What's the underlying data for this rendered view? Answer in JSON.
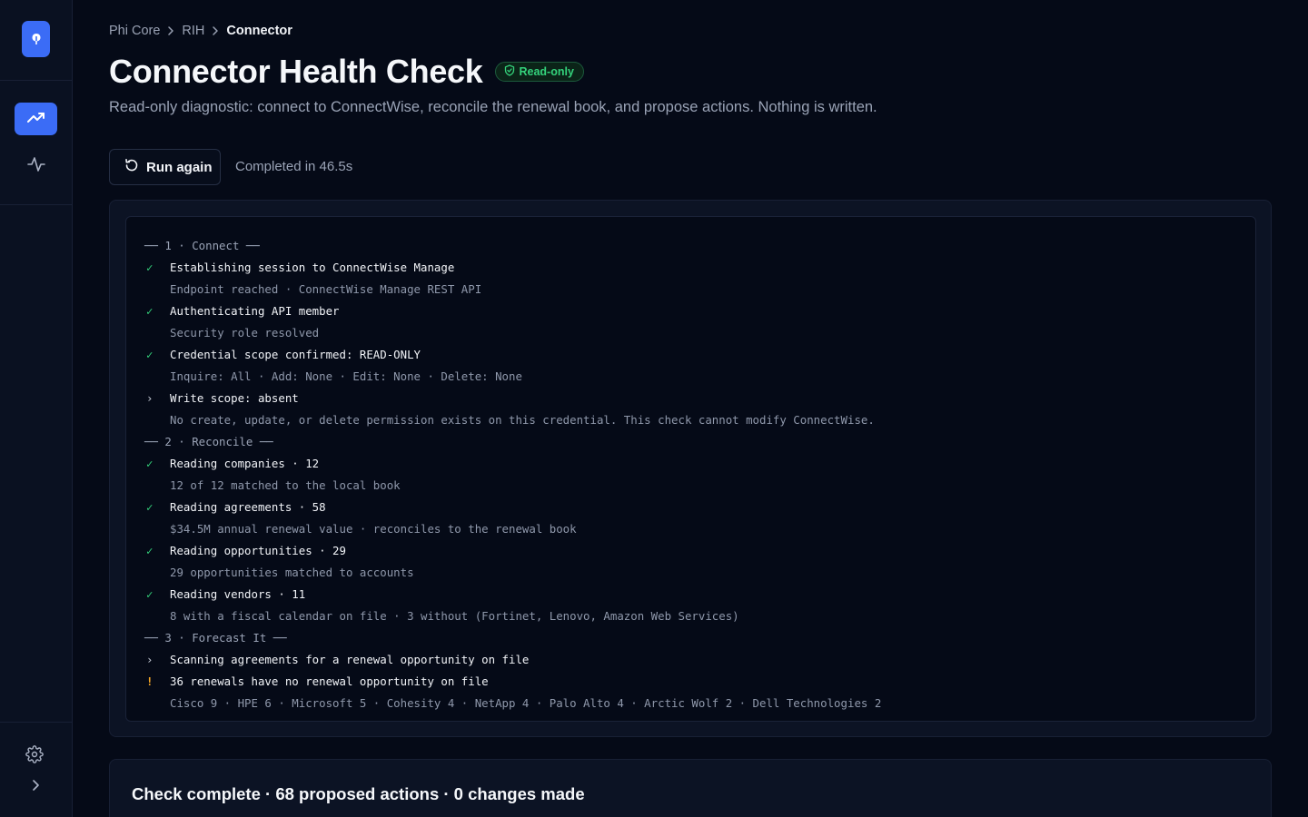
{
  "colors": {
    "accent": "#3b6cf6",
    "success": "#34d27b",
    "warning": "#f5a524",
    "background": "#050a17"
  },
  "sidebar": {
    "logo_icon": "leaf-logo-icon",
    "nav": [
      {
        "icon": "trending-up-icon",
        "active": true
      },
      {
        "icon": "activity-pulse-icon",
        "active": false
      }
    ],
    "footer": [
      {
        "icon": "gear-icon"
      },
      {
        "icon": "chevron-right-icon"
      }
    ]
  },
  "breadcrumb": [
    "Phi Core",
    "RIH",
    "Connector"
  ],
  "header": {
    "title": "Connector Health Check",
    "badge": "Read-only",
    "subtitle": "Read-only diagnostic: connect to ConnectWise, reconcile the renewal book, and propose actions. Nothing is written."
  },
  "actions": {
    "run_again": "Run again",
    "completed": "Completed in 46.5s"
  },
  "log": [
    {
      "kind": "section",
      "text": "── 1 · Connect ──"
    },
    {
      "kind": "main",
      "marker": "ok",
      "text": "Establishing session to ConnectWise Manage"
    },
    {
      "kind": "sub",
      "text": "Endpoint reached · ConnectWise Manage REST API"
    },
    {
      "kind": "main",
      "marker": "ok",
      "text": "Authenticating API member"
    },
    {
      "kind": "sub",
      "text": "Security role resolved"
    },
    {
      "kind": "main",
      "marker": "ok",
      "text": "Credential scope confirmed: READ-ONLY"
    },
    {
      "kind": "sub",
      "text": "Inquire: All · Add: None · Edit: None · Delete: None"
    },
    {
      "kind": "main",
      "marker": "arrow",
      "text": "Write scope: absent"
    },
    {
      "kind": "sub",
      "text": "No create, update, or delete permission exists on this credential. This check cannot modify ConnectWise."
    },
    {
      "kind": "section",
      "text": "── 2 · Reconcile ──"
    },
    {
      "kind": "main",
      "marker": "ok",
      "text": "Reading companies · 12"
    },
    {
      "kind": "sub",
      "text": "12 of 12 matched to the local book"
    },
    {
      "kind": "main",
      "marker": "ok",
      "text": "Reading agreements · 58"
    },
    {
      "kind": "sub",
      "text": "$34.5M annual renewal value · reconciles to the renewal book"
    },
    {
      "kind": "main",
      "marker": "ok",
      "text": "Reading opportunities · 29"
    },
    {
      "kind": "sub",
      "text": "29 opportunities matched to accounts"
    },
    {
      "kind": "main",
      "marker": "ok",
      "text": "Reading vendors · 11"
    },
    {
      "kind": "sub",
      "text": "8 with a fiscal calendar on file · 3 without (Fortinet, Lenovo, Amazon Web Services)"
    },
    {
      "kind": "section",
      "text": "── 3 · Forecast It ──"
    },
    {
      "kind": "main",
      "marker": "arrow",
      "text": "Scanning agreements for a renewal opportunity on file"
    },
    {
      "kind": "main",
      "marker": "warn",
      "text": "36 renewals have no renewal opportunity on file"
    },
    {
      "kind": "sub",
      "text": "Cisco 9 · HPE 6 · Microsoft 5 · Cohesity 4 · NetApp 4 · Palo Alto 4 · Arctic Wolf 2 · Dell Technologies 2"
    }
  ],
  "markers": {
    "ok": "✓",
    "arrow": "›",
    "warn": "!"
  },
  "summary": "Check complete · 68 proposed actions · 0 changes made"
}
